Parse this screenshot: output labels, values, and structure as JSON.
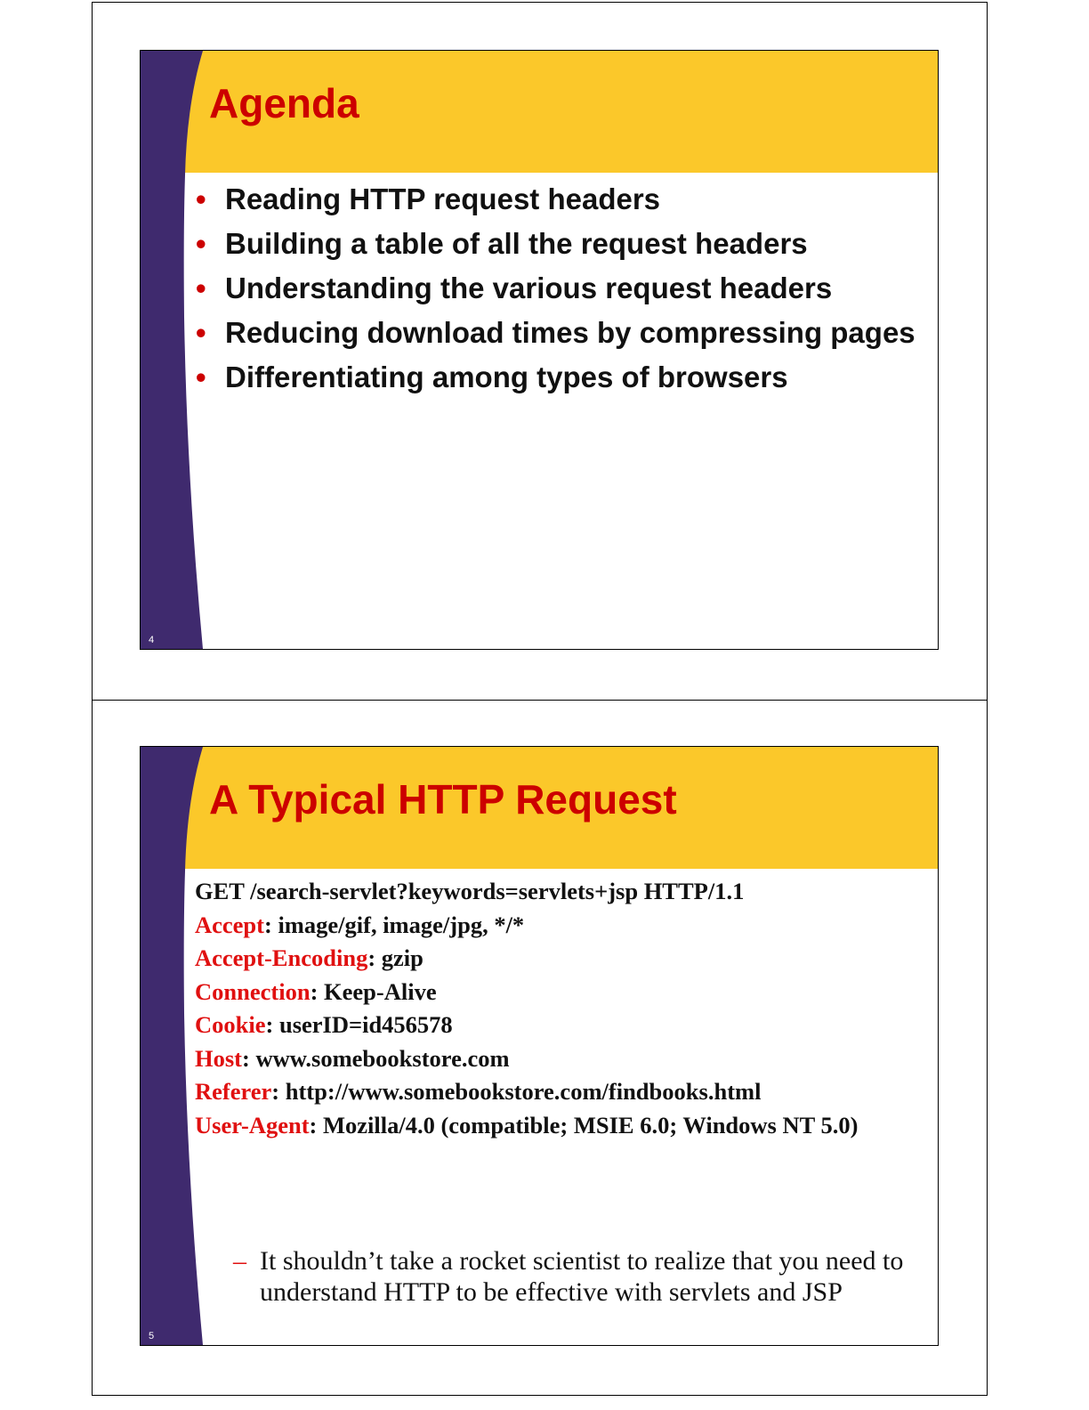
{
  "slides": [
    {
      "number": "4",
      "title": "Agenda",
      "bullet": "•",
      "items": [
        "Reading HTTP request headers",
        "Building a table of all the request headers",
        "Understanding the various request headers",
        "Reducing download times by compressing pages",
        "Differentiating among types of browsers"
      ]
    },
    {
      "number": "5",
      "title": "A Typical HTTP Request",
      "request_line": "GET /search-servlet?keywords=servlets+jsp HTTP/1.1",
      "headers": [
        {
          "name": "Accept",
          "value": ": image/gif, image/jpg, */*"
        },
        {
          "name": "Accept-Encoding",
          "value": ": gzip"
        },
        {
          "name": "Connection",
          "value": ": Keep-Alive"
        },
        {
          "name": "Cookie",
          "value": ": userID=id456578"
        },
        {
          "name": "Host",
          "value": ": www.somebookstore.com"
        },
        {
          "name": "Referer",
          "value": ": http://www.somebookstore.com/findbooks.html"
        },
        {
          "name": "User-Agent",
          "value": ": Mozilla/4.0 (compatible; MSIE 6.0; Windows NT 5.0)"
        }
      ],
      "note_dash": "–",
      "note": "It shouldn’t take a rocket scientist to realize that you need to understand HTTP to be effective with servlets and JSP"
    }
  ],
  "colors": {
    "banner": "#fbc82a",
    "sidebar": "#3f2a6e",
    "title": "#cc0000",
    "header_name": "#e01010"
  }
}
